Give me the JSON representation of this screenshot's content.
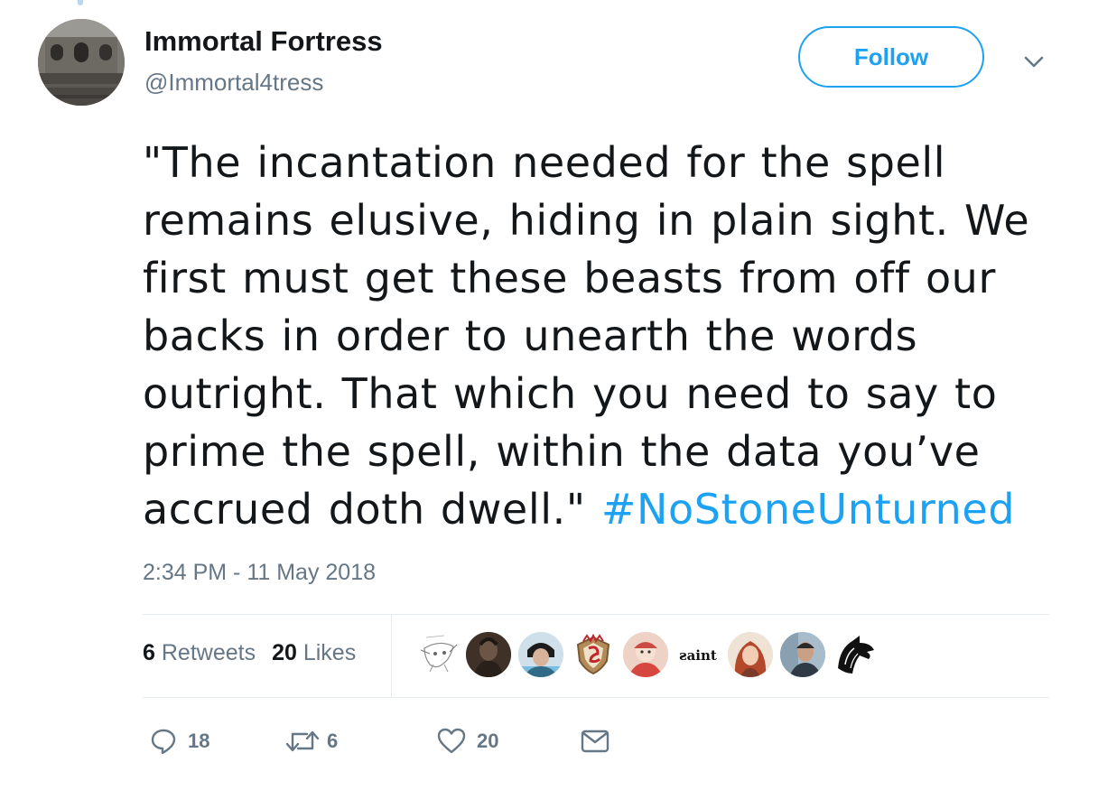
{
  "tweet": {
    "author": {
      "name": "Immortal Fortress",
      "handle": "@Immortal4tress"
    },
    "follow_label": "Follow",
    "text_lines": [
      "\"The incantation needed for the spell",
      "remains elusive, hiding in plain sight. We",
      "first must get these beasts from off our",
      "backs in order to unearth the words",
      "outright. That which you need to say to",
      "prime the spell, within the data you’ve",
      "accrued doth dwell.\" "
    ],
    "hashtag": "#NoStoneUnturned",
    "timestamp": "2:34 PM - 11 May 2018",
    "stats": {
      "retweets_count": "6",
      "retweets_label": "Retweets",
      "likes_count": "20",
      "likes_label": "Likes"
    },
    "liker_avatars": [
      {
        "icon": "sketch-avatar"
      },
      {
        "icon": "dark-warrior-avatar"
      },
      {
        "icon": "person-avatar"
      },
      {
        "icon": "crest-avatar"
      },
      {
        "icon": "cartoon-avatar"
      },
      {
        "icon": "text-logo-avatar",
        "text": "ƨaint"
      },
      {
        "icon": "redhead-avatar"
      },
      {
        "icon": "man-avatar"
      },
      {
        "icon": "wolf-avatar"
      }
    ],
    "actions": {
      "reply_count": "18",
      "retweet_count": "6",
      "like_count": "20"
    }
  },
  "colors": {
    "accent": "#1da1f2",
    "text": "#14171a",
    "secondary": "#657786",
    "divider": "#e6ecf0"
  }
}
